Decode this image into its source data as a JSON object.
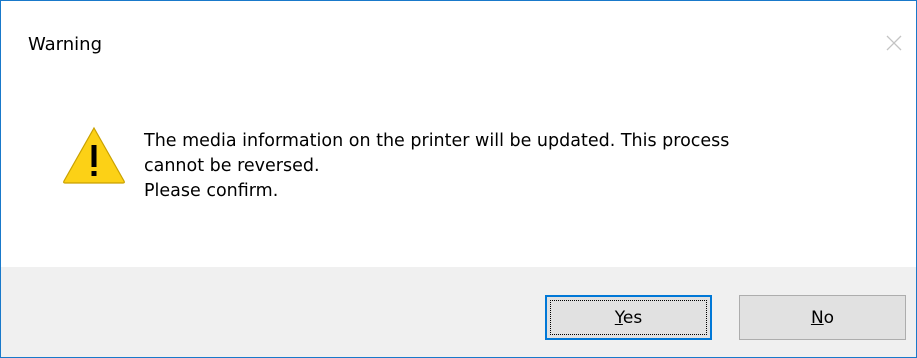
{
  "dialog": {
    "title": "Warning",
    "icon": "warning-icon",
    "message_lines": [
      "The media information on the printer will be updated. This process",
      "cannot be reversed.",
      "Please confirm."
    ]
  },
  "buttons": {
    "yes": {
      "mnemonic": "Y",
      "rest": "es"
    },
    "no": {
      "mnemonic": "N",
      "rest": "o"
    }
  },
  "colors": {
    "accent": "#0078d7",
    "window_border": "#1979ca",
    "footer_bg": "#f0f0f0",
    "warning_yellow": "#fcd116"
  }
}
